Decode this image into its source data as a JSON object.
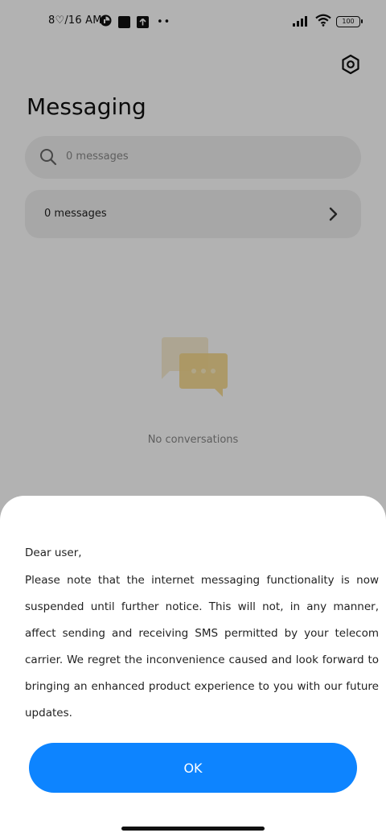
{
  "status_bar": {
    "time": "8♡/16 AM",
    "battery_level": "100",
    "more_indicator": "••"
  },
  "header": {
    "title": "Messaging",
    "settings_icon": "gear-icon"
  },
  "search": {
    "placeholder": "0 messages"
  },
  "messages_row": {
    "label": "0 messages"
  },
  "empty_state": {
    "text": "No conversations"
  },
  "dialog": {
    "greeting": "Dear user,",
    "body": "Please note that the internet messaging functionality is now suspended until further notice. This will not, in any manner, affect sending and receiving SMS permitted by your telecom carrier. We regret the inconvenience caused and look forward to bringing an enhanced product experience to you with our future updates.",
    "ok_label": "OK"
  },
  "colors": {
    "accent": "#0d84ff",
    "overlay": "rgba(0,0,0,0.30)",
    "illustration": "#f5d78a"
  }
}
